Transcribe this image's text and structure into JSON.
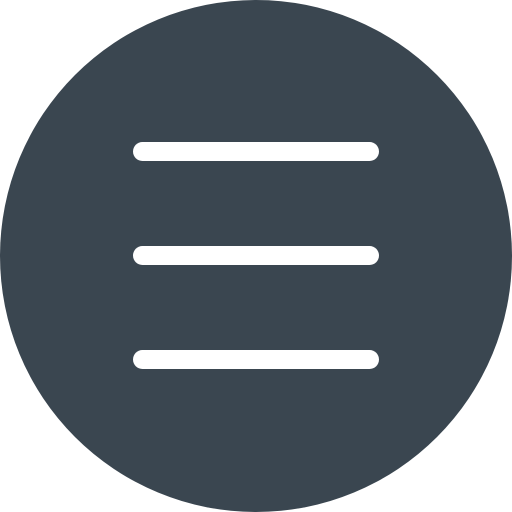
{
  "menu_button": {
    "icon": "hamburger-menu-icon",
    "background_color": "#3a4650",
    "line_color": "#ffffff",
    "line_count": 3
  }
}
